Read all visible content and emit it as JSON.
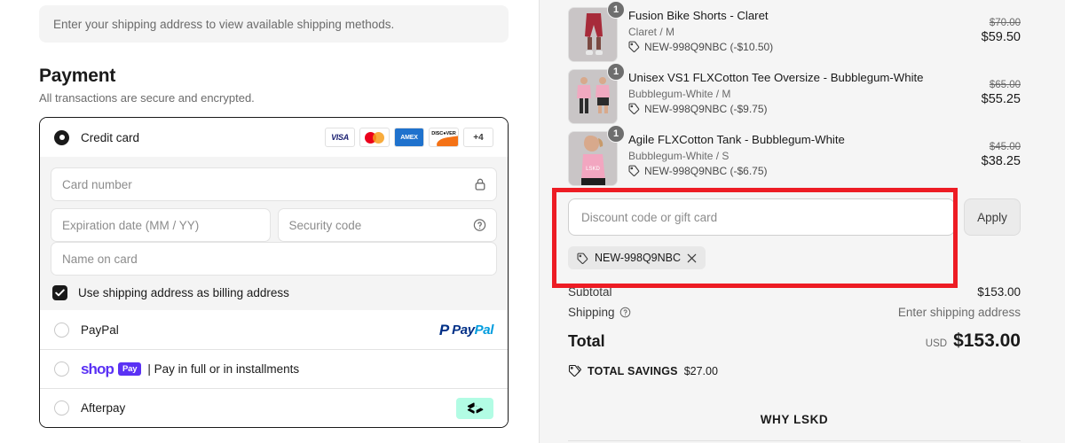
{
  "left": {
    "shipping_notice": "Enter your shipping address to view available shipping methods.",
    "payment_heading": "Payment",
    "payment_subtitle": "All transactions are secure and encrypted.",
    "credit_card": {
      "label": "Credit card",
      "brands": [
        "VISA",
        "mastercard",
        "AMEX",
        "DISCOVER"
      ],
      "more_label": "+4",
      "fields": {
        "card_number_placeholder": "Card number",
        "expiry_placeholder": "Expiration date (MM / YY)",
        "security_placeholder": "Security code",
        "name_placeholder": "Name on card"
      },
      "billing_checkbox_label": "Use shipping address as billing address",
      "billing_checked": true
    },
    "paypal": {
      "label": "PayPal",
      "logo_pay": "Pay",
      "logo_pal": "Pal"
    },
    "shop_pay": {
      "brand": "shop",
      "badge": "Pay",
      "description": "| Pay in full or in installments"
    },
    "afterpay": {
      "label": "Afterpay"
    }
  },
  "right": {
    "items": [
      {
        "title": "Fusion Bike Shorts - Claret",
        "variant": "Claret / M",
        "discount": "NEW-998Q9NBC (-$10.50)",
        "qty": "1",
        "old_price": "$70.00",
        "new_price": "$59.50"
      },
      {
        "title": "Unisex VS1 FLXCotton Tee Oversize - Bubblegum-White",
        "variant": "Bubblegum-White / M",
        "discount": "NEW-998Q9NBC (-$9.75)",
        "qty": "1",
        "old_price": "$65.00",
        "new_price": "$55.25"
      },
      {
        "title": "Agile FLXCotton Tank - Bubblegum-White",
        "variant": "Bubblegum-White / S",
        "discount": "NEW-998Q9NBC (-$6.75)",
        "qty": "1",
        "old_price": "$45.00",
        "new_price": "$38.25"
      }
    ],
    "discount": {
      "input_placeholder": "Discount code or gift card",
      "apply_label": "Apply",
      "applied_code": "NEW-998Q9NBC"
    },
    "totals": {
      "subtotal_label": "Subtotal",
      "subtotal_value": "$153.00",
      "shipping_label": "Shipping",
      "shipping_value": "Enter shipping address",
      "total_label": "Total",
      "currency": "USD",
      "total_value": "$153.00",
      "savings_label": "TOTAL SAVINGS",
      "savings_value": "$27.00"
    },
    "why_title": "WHY LSKD"
  },
  "highlight": {
    "color": "#ed1c24"
  }
}
